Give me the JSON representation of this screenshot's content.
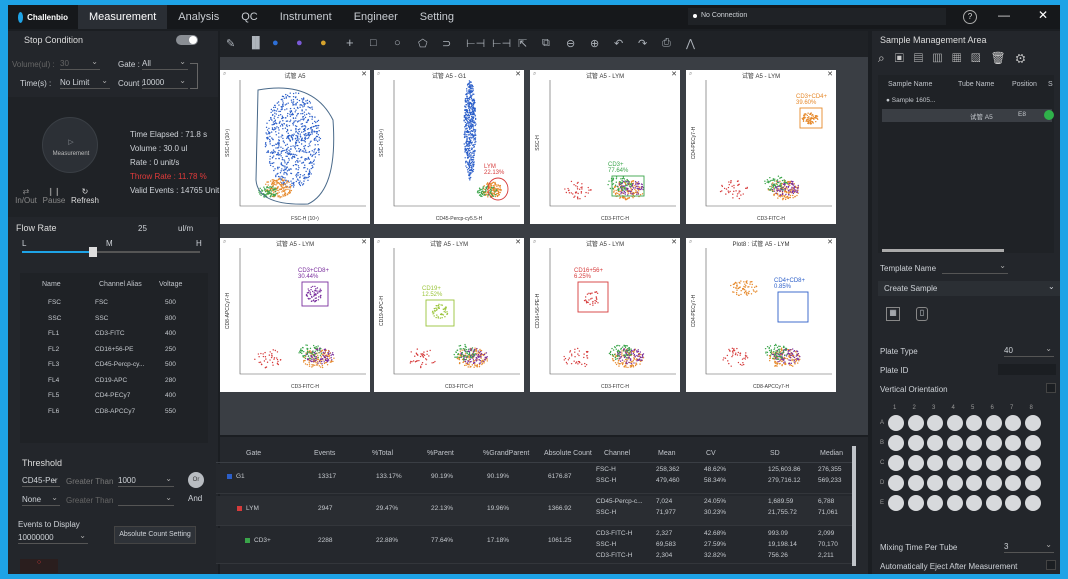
{
  "app": {
    "logo": "Challenbio",
    "connection": "No Connection"
  },
  "nav": [
    "Measurement",
    "Analysis",
    "QC",
    "Instrument",
    "Engineer",
    "Setting"
  ],
  "window": {
    "help": "?",
    "minimize": "—",
    "close": "✕"
  },
  "stop_condition": {
    "title": "Stop Condition",
    "volume_label": "Volume(ul) :",
    "volume_value": "30",
    "gate_label": "Gate :",
    "gate_value": "All",
    "time_label": "Time(s) :",
    "time_value": "No Limit",
    "count_label": "Count :",
    "count_value": "10000"
  },
  "measurement": {
    "button": "Measurement",
    "time_elapsed": "Time Elapsed : 71.8 s",
    "volume": "Volume : 30.0 ul",
    "rate": "Rate : 0 unit/s",
    "throw_rate": "Throw Rate : 11.78 %",
    "valid_events": "Valid Events : 14765 Unit",
    "inout": "In/Out",
    "pause": "Pause",
    "refresh": "Refresh"
  },
  "flow_rate": {
    "title": "Flow Rate",
    "value": "25",
    "unit": "ul/m",
    "low": "L",
    "mid": "M",
    "high": "H",
    "level": 0.4
  },
  "channels": {
    "headers": [
      "Name",
      "Channel Alias",
      "Voltage"
    ],
    "rows": [
      [
        "FSC",
        "FSC",
        "500"
      ],
      [
        "SSC",
        "SSC",
        "800"
      ],
      [
        "FL1",
        "CD3-FITC",
        "400"
      ],
      [
        "FL2",
        "CD16+56-PE",
        "250"
      ],
      [
        "FL3",
        "CD45-Percp-cy...",
        "500"
      ],
      [
        "FL4",
        "CD19-APC",
        "280"
      ],
      [
        "FL5",
        "CD4-PECy7",
        "400"
      ],
      [
        "FL6",
        "CD8-APCCy7",
        "550"
      ]
    ]
  },
  "threshold": {
    "title": "Threshold",
    "ch1": "CD45-Per",
    "cond1": "Greater Than",
    "val1": "1000",
    "ch2": "None",
    "cond2": "Greater Than",
    "or": "Or",
    "and": "And",
    "events_label": "Events to Display",
    "events_value": "10000000",
    "abs_count": "Absolute Count Setting"
  },
  "plots": [
    {
      "title": "试管 A5",
      "xlabel": "FSC-H (10⁴)",
      "ylabel": "SSC-H (10⁴)",
      "gate": "",
      "gate_pct": ""
    },
    {
      "title": "试管 A5 - G1",
      "xlabel": "CD45-Percp-cy5.5-H",
      "ylabel": "SSC-H (10⁴)",
      "gate": "LYM",
      "gate_pct": "22.13%"
    },
    {
      "title": "试管 A5 - LYM",
      "xlabel": "CD3-FITC-H",
      "ylabel": "SSC-H",
      "gate": "CD3+",
      "gate_pct": "77.64%"
    },
    {
      "title": "试管 A5 - LYM",
      "xlabel": "CD3-FITC-H",
      "ylabel": "CD4-PECy7-H",
      "gate": "CD3+CD4+",
      "gate_pct": "39.60%"
    },
    {
      "title": "试管 A5 - LYM",
      "xlabel": "CD3-FITC-H",
      "ylabel": "CD8-APCCy7-H",
      "gate": "CD3+CD8+",
      "gate_pct": "30.44%"
    },
    {
      "title": "试管 A5 - LYM",
      "xlabel": "CD3-FITC-H",
      "ylabel": "CD19-APC-H",
      "gate": "CD19+",
      "gate_pct": "12.52%"
    },
    {
      "title": "试管 A5 - LYM",
      "xlabel": "CD3-FITC-H",
      "ylabel": "CD16+56-PE-H",
      "gate": "CD16+56+",
      "gate_pct": "6.25%"
    },
    {
      "title": "Plot8 : 试管 A5 - LYM",
      "xlabel": "CD8-APCCy7-H",
      "ylabel": "CD4-PECy7-H",
      "gate": "CD4+CD8+",
      "gate_pct": "0.85%"
    }
  ],
  "stats": {
    "headers": [
      "Gate",
      "Events",
      "%Total",
      "%Parent",
      "%GrandParent",
      "Absolute Count",
      "Channel",
      "Mean",
      "CV",
      "SD",
      "Median"
    ],
    "rows": [
      {
        "gate": "G1",
        "events": "13317",
        "total": "133.17%",
        "parent": "90.19%",
        "gp": "90.19%",
        "abs": "6176.87",
        "ch": [
          "FSC-H",
          "SSC-H"
        ],
        "mean": [
          "258,362",
          "479,460"
        ],
        "cv": [
          "48.62%",
          "58.34%"
        ],
        "sd": [
          "125,603.86",
          "279,716.12"
        ],
        "median": [
          "276,355",
          "569,233"
        ]
      },
      {
        "gate": "LYM",
        "events": "2947",
        "total": "29.47%",
        "parent": "22.13%",
        "gp": "19.96%",
        "abs": "1366.92",
        "ch": [
          "CD45-Percp-c...",
          "SSC-H"
        ],
        "mean": [
          "7,024",
          "71,977"
        ],
        "cv": [
          "24.05%",
          "30.23%"
        ],
        "sd": [
          "1,689.59",
          "21,755.72"
        ],
        "median": [
          "6,788",
          "71,061"
        ]
      },
      {
        "gate": "CD3+",
        "events": "2288",
        "total": "22.88%",
        "parent": "77.64%",
        "gp": "17.18%",
        "abs": "1061.25",
        "ch": [
          "CD3-FITC-H",
          "SSC-H",
          "CD3-FITC-H"
        ],
        "mean": [
          "2,327",
          "69,583",
          "2,304"
        ],
        "cv": [
          "42.68%",
          "27.59%",
          "32.82%"
        ],
        "sd": [
          "993.09",
          "19,198.14",
          "756.26"
        ],
        "median": [
          "2,099",
          "70,170",
          "2,211"
        ]
      }
    ]
  },
  "sample_mgmt": {
    "title": "Sample Management Area",
    "headers": [
      "Sample Name",
      "Tube Name",
      "Position",
      "S"
    ],
    "sample": "Sample 1605...",
    "tube": "试管 A5",
    "position": "E8",
    "template_label": "Template Name",
    "create_sample": "Create Sample",
    "plate_type_label": "Plate Type",
    "plate_type_value": "40",
    "plate_id_label": "Plate ID",
    "vertical_label": "Vertical Orientation",
    "cols": [
      "1",
      "2",
      "3",
      "4",
      "5",
      "6",
      "7",
      "8"
    ],
    "rows": [
      "A",
      "B",
      "C",
      "D",
      "E"
    ],
    "mixing_label": "Mixing Time Per Tube",
    "mixing_value": "3",
    "eject_label": "Automatically Eject After Measurement"
  },
  "colors": {
    "accent": "#1ea3e6",
    "status_green": "#2fb24a",
    "alert_red": "#e23b3b"
  }
}
